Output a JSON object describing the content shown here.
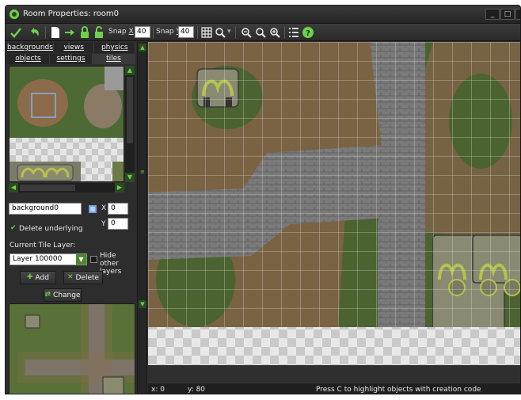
{
  "window": {
    "title": "Room Properties: room0",
    "controls": {
      "minimize": "_",
      "maximize": "□",
      "close": "✕"
    }
  },
  "toolbar": {
    "snap_x_label": "Snap",
    "snap_x_letter": "X",
    "snap_x_value": "40",
    "snap_y_label": "Snap",
    "snap_y_letter": "Y",
    "snap_y_value": "40",
    "icons": [
      "ok-icon",
      "undo-icon",
      "new-icon",
      "shift-icon",
      "lock-icon",
      "unlock-icon",
      "grid-icon",
      "zoom-icon",
      "zoom-out-icon",
      "zoom-reset-icon",
      "zoom-in-icon",
      "list-icon",
      "help-icon"
    ]
  },
  "tabs": {
    "row1": [
      "backgrounds",
      "views",
      "physics"
    ],
    "row2": [
      "objects",
      "settings",
      "tiles"
    ],
    "active": "tiles"
  },
  "tiles": {
    "background_name": "background0",
    "x_label": "X",
    "x_value": "0",
    "y_label": "Y",
    "y_value": "0",
    "delete_underlying_label": "Delete underlying",
    "delete_underlying_checked": true,
    "current_tile_layer_label": "Current Tile Layer:",
    "layer_value": "Layer 100000",
    "hide_other_layers_label": "Hide other layers",
    "hide_other_layers_checked": false,
    "add_label": "Add",
    "delete_label": "Delete",
    "change_label": "Change"
  },
  "status": {
    "x": "x: 0",
    "y": "y: 80",
    "hint": "Press C to highlight objects with creation code"
  },
  "colors": {
    "accent_green": "#6fd04a",
    "window_bg": "#2f2f2f",
    "grass": "#4a5e32",
    "road": "#7a7a7a",
    "dirt": "#8b6a4a"
  }
}
